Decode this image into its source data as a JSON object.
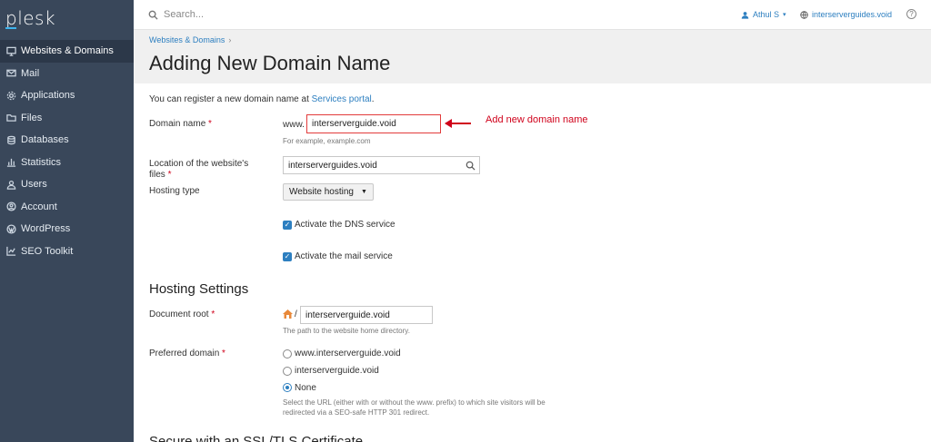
{
  "app": {
    "logo": "plesk"
  },
  "sidebar": {
    "items": [
      {
        "label": "Websites & Domains",
        "icon": "monitor-icon",
        "active": true
      },
      {
        "label": "Mail",
        "icon": "mail-icon"
      },
      {
        "label": "Applications",
        "icon": "gear-icon"
      },
      {
        "label": "Files",
        "icon": "folder-icon"
      },
      {
        "label": "Databases",
        "icon": "database-icon"
      },
      {
        "label": "Statistics",
        "icon": "bar-chart-icon"
      },
      {
        "label": "Users",
        "icon": "user-icon"
      },
      {
        "label": "Account",
        "icon": "account-icon"
      },
      {
        "label": "WordPress",
        "icon": "wordpress-icon"
      },
      {
        "label": "SEO Toolkit",
        "icon": "seo-icon"
      }
    ],
    "collapse_glyph": "‹"
  },
  "topbar": {
    "search_placeholder": "Search...",
    "user_name": "Athul S",
    "subscription": "interserverguides.void",
    "help": "?"
  },
  "header": {
    "breadcrumb": "Websites & Domains",
    "breadcrumb_sep": "›",
    "title": "Adding New Domain Name"
  },
  "form": {
    "intro_text": "You can register a new domain name at ",
    "intro_link": "Services portal",
    "intro_end": ".",
    "domain_label": "Domain name",
    "required_mark": "*",
    "www_prefix": "www.",
    "domain_value": "interserverguide.void",
    "domain_hint": "For example, example.com",
    "location_label_line1": "Location of the website's",
    "location_label_line2": "files",
    "location_value": "interserverguides.void",
    "hosting_type_label": "Hosting type",
    "hosting_type_value": "Website hosting",
    "dns_label": "Activate the DNS service",
    "mail_label": "Activate the mail service",
    "annotation": "Add new domain name"
  },
  "hosting_settings": {
    "title": "Hosting Settings",
    "docroot_label": "Document root",
    "docroot_slash": "/",
    "docroot_value": "interserverguide.void",
    "docroot_hint": "The path to the website home directory.",
    "preferred_label": "Preferred domain",
    "options": [
      "www.interserverguide.void",
      "interserverguide.void",
      "None"
    ],
    "selected_option": "None",
    "preferred_hint_line1": "Select the URL (either with or without the www. prefix) to which site visitors will be",
    "preferred_hint_line2": "redirected via a SEO-safe HTTP 301 redirect."
  },
  "ssl_section": {
    "title": "Secure with an SSL/TLS Certificate"
  },
  "colors": {
    "sidebar": "#39475a",
    "accent": "#2d7fc0",
    "annotation": "#d0021b"
  }
}
